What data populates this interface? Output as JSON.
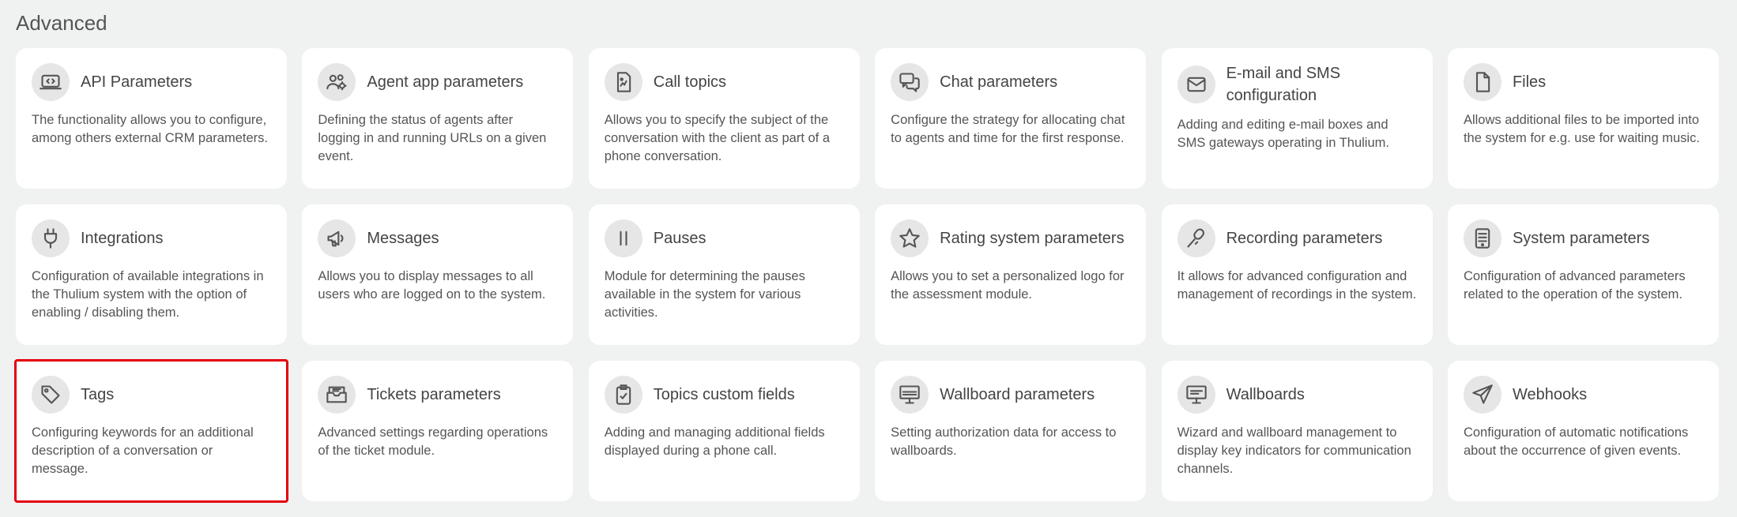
{
  "section": {
    "title": "Advanced"
  },
  "cards": [
    {
      "title": "API Parameters",
      "icon": "api-icon",
      "desc": "The functionality allows you to configure, among others external CRM parameters."
    },
    {
      "title": "Agent app parameters",
      "icon": "users-gear-icon",
      "desc": "Defining the status of agents after logging in and running URLs on a given event."
    },
    {
      "title": "Call topics",
      "icon": "document-icon",
      "desc": "Allows you to specify the subject of the conversation with the client as part of a phone conversation."
    },
    {
      "title": "Chat parameters",
      "icon": "chat-icon",
      "desc": "Configure the strategy for allocating chat to agents and time for the first response."
    },
    {
      "title": "E-mail and SMS configuration",
      "icon": "envelope-icon",
      "desc": "Adding and editing e-mail boxes and SMS gateways operating in Thulium."
    },
    {
      "title": "Files",
      "icon": "file-icon",
      "desc": "Allows additional files to be imported into the system for e.g. use for waiting music."
    },
    {
      "title": "Integrations",
      "icon": "plug-icon",
      "desc": "Configuration of available integrations in the Thulium system with the option of enabling / disabling them."
    },
    {
      "title": "Messages",
      "icon": "megaphone-icon",
      "desc": "Allows you to display messages to all users who are logged on to the system."
    },
    {
      "title": "Pauses",
      "icon": "pause-icon",
      "desc": "Module for determining the pauses available in the system for various activities."
    },
    {
      "title": "Rating system parameters",
      "icon": "star-icon",
      "desc": "Allows you to set a personalized logo for the assessment module."
    },
    {
      "title": "Recording parameters",
      "icon": "microphone-icon",
      "desc": "It allows for advanced configuration and management of recordings in the system."
    },
    {
      "title": "System parameters",
      "icon": "server-icon",
      "desc": "Configuration of advanced parameters related to the operation of the system."
    },
    {
      "title": "Tags",
      "icon": "tags-icon",
      "desc": "Configuring keywords for an additional description of a conversation or message."
    },
    {
      "title": "Tickets parameters",
      "icon": "inbox-icon",
      "desc": "Advanced settings regarding operations of the ticket module."
    },
    {
      "title": "Topics custom fields",
      "icon": "clipboard-check-icon",
      "desc": "Adding and managing additional fields displayed during a phone call."
    },
    {
      "title": "Wallboard parameters",
      "icon": "monitor-icon",
      "desc": "Setting authorization data for access to wallboards."
    },
    {
      "title": "Wallboards",
      "icon": "display-icon",
      "desc": "Wizard and wallboard management to display key indicators for communication channels."
    },
    {
      "title": "Webhooks",
      "icon": "paper-plane-icon",
      "desc": "Configuration of automatic notifications about the occurrence of given events."
    }
  ],
  "selected_index": 12,
  "colors": {
    "selected_border": "#e3000f",
    "card_bg": "#ffffff",
    "page_bg": "#f0f1f1"
  }
}
